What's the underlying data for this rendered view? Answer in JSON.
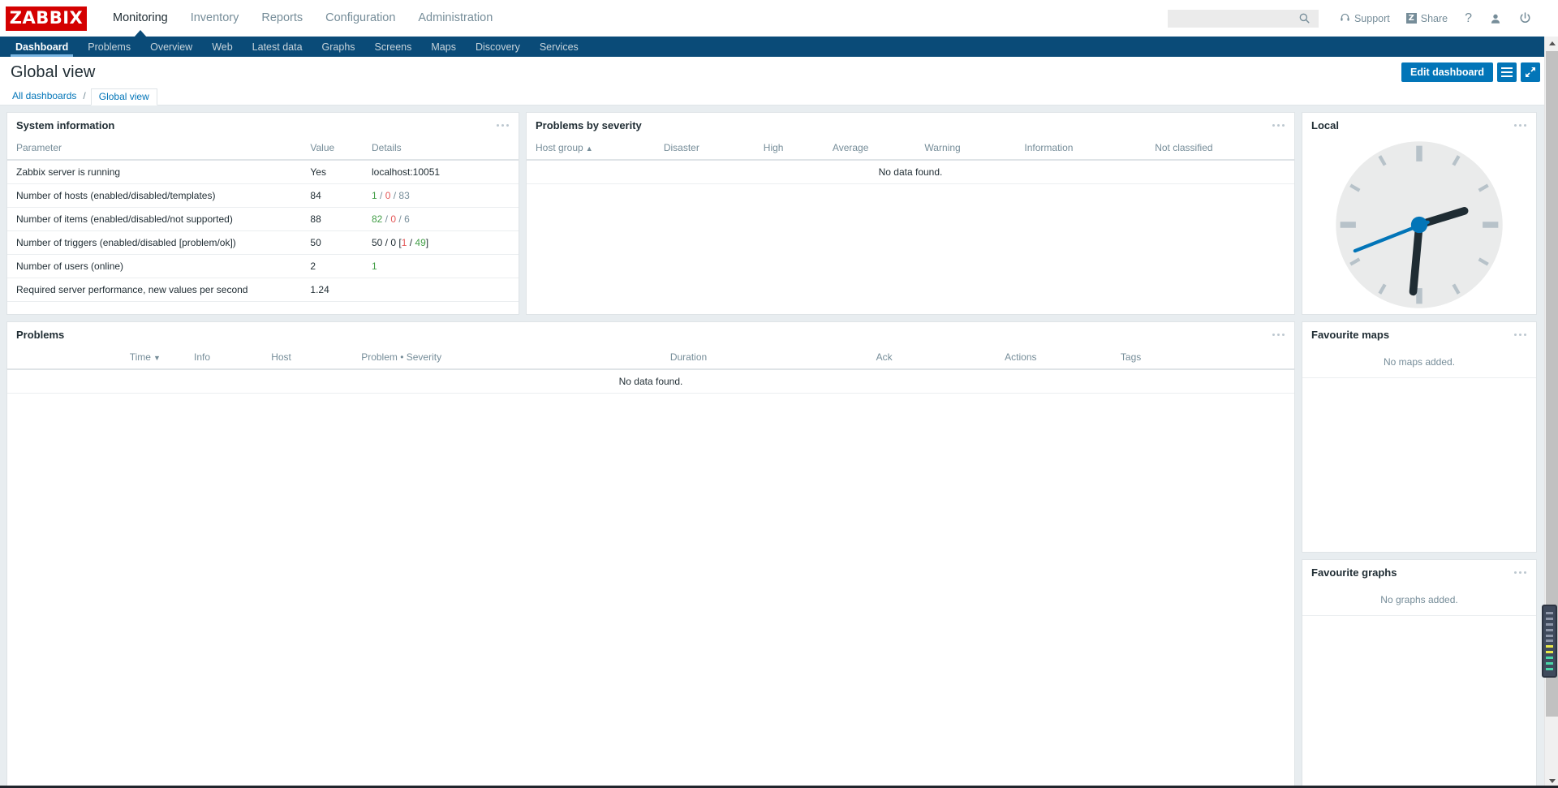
{
  "brand": {
    "logo_text": "ZABBIX",
    "logo_bg": "#d40000"
  },
  "theme": {
    "accent": "#0275b8",
    "nav_bg": "#0a4b78",
    "page_bg": "#e8edf0",
    "green": "#429e47",
    "red": "#e45959",
    "muted": "#768d99"
  },
  "header": {
    "main_menu": [
      {
        "label": "Monitoring",
        "active": true
      },
      {
        "label": "Inventory",
        "active": false
      },
      {
        "label": "Reports",
        "active": false
      },
      {
        "label": "Configuration",
        "active": false
      },
      {
        "label": "Administration",
        "active": false
      }
    ],
    "search": {
      "value": "",
      "placeholder": ""
    },
    "support_label": "Support",
    "share_label": "Share",
    "share_badge": "Z",
    "help_label": "?",
    "icons": [
      "search-icon",
      "support-icon",
      "share-icon",
      "help-icon",
      "user-icon",
      "signout-icon"
    ]
  },
  "subnav": {
    "items": [
      {
        "label": "Dashboard",
        "active": true
      },
      {
        "label": "Problems",
        "active": false
      },
      {
        "label": "Overview",
        "active": false
      },
      {
        "label": "Web",
        "active": false
      },
      {
        "label": "Latest data",
        "active": false
      },
      {
        "label": "Graphs",
        "active": false
      },
      {
        "label": "Screens",
        "active": false
      },
      {
        "label": "Maps",
        "active": false
      },
      {
        "label": "Discovery",
        "active": false
      },
      {
        "label": "Services",
        "active": false
      }
    ]
  },
  "page": {
    "title": "Global view",
    "edit_button": "Edit dashboard",
    "menu_icon": "hamburger-icon",
    "fullscreen_icon": "expand-icon"
  },
  "breadcrumb": {
    "all_dashboards": "All dashboards",
    "separator": "/",
    "current": "Global view"
  },
  "widgets": {
    "system_information": {
      "title": "System information",
      "columns": [
        "Parameter",
        "Value",
        "Details"
      ],
      "rows": [
        {
          "parameter": "Zabbix server is running",
          "value": "Yes",
          "value_color": "green",
          "details": [
            {
              "text": "localhost:10051",
              "color": "dark"
            }
          ]
        },
        {
          "parameter": "Number of hosts (enabled/disabled/templates)",
          "value": "84",
          "value_color": "dark",
          "details": [
            {
              "text": "1",
              "color": "green"
            },
            {
              "text": " / ",
              "color": "gray"
            },
            {
              "text": "0",
              "color": "red"
            },
            {
              "text": " / ",
              "color": "gray"
            },
            {
              "text": "83",
              "color": "gray"
            }
          ]
        },
        {
          "parameter": "Number of items (enabled/disabled/not supported)",
          "value": "88",
          "value_color": "dark",
          "details": [
            {
              "text": "82",
              "color": "green"
            },
            {
              "text": " / ",
              "color": "gray"
            },
            {
              "text": "0",
              "color": "red"
            },
            {
              "text": " / ",
              "color": "gray"
            },
            {
              "text": "6",
              "color": "gray"
            }
          ]
        },
        {
          "parameter": "Number of triggers (enabled/disabled [problem/ok])",
          "value": "50",
          "value_color": "dark",
          "details": [
            {
              "text": "50 / 0 [",
              "color": "dark"
            },
            {
              "text": "1",
              "color": "red"
            },
            {
              "text": " / ",
              "color": "dark"
            },
            {
              "text": "49",
              "color": "green"
            },
            {
              "text": "]",
              "color": "dark"
            }
          ]
        },
        {
          "parameter": "Number of users (online)",
          "value": "2",
          "value_color": "dark",
          "details": [
            {
              "text": "1",
              "color": "green"
            }
          ]
        },
        {
          "parameter": "Required server performance, new values per second",
          "value": "1.24",
          "value_color": "dark",
          "details": []
        }
      ]
    },
    "problems_by_severity": {
      "title": "Problems by severity",
      "columns": [
        "Host group",
        "Disaster",
        "High",
        "Average",
        "Warning",
        "Information",
        "Not classified"
      ],
      "sorted_column": "Host group",
      "sort_direction": "asc",
      "sort_glyph": "▲",
      "empty_text": "No data found."
    },
    "local_clock": {
      "title": "Local",
      "type": "analog",
      "hour_angle": 85,
      "minute_angle": 185,
      "second_angle": 242,
      "face_color": "#eaebeb",
      "hand_color": "#1f2c33",
      "second_hand_color": "#0275b8"
    },
    "problems": {
      "title": "Problems",
      "columns": [
        "",
        "Time",
        "Info",
        "Host",
        "Problem • Severity",
        "Duration",
        "Ack",
        "Actions",
        "Tags"
      ],
      "sorted_column": "Time",
      "sort_direction": "desc",
      "sort_glyph": "▼",
      "empty_text": "No data found."
    },
    "favourite_maps": {
      "title": "Favourite maps",
      "empty_text": "No maps added."
    },
    "favourite_graphs": {
      "title": "Favourite graphs",
      "empty_text": "No graphs added."
    }
  },
  "scrollbar": {
    "up_glyph": "▲",
    "down_glyph": "▼"
  }
}
